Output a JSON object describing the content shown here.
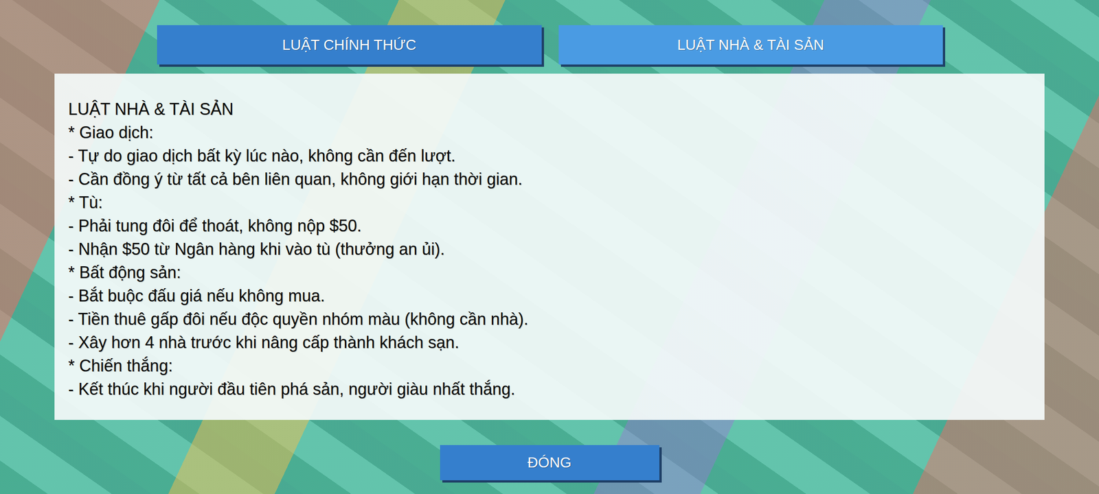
{
  "tabs": [
    {
      "label": "LUẬT CHÍNH THỨC",
      "selected": false
    },
    {
      "label": "LUẬT NHÀ & TÀI SẢN",
      "selected": true
    }
  ],
  "panel": {
    "lines": [
      {
        "kind": "title",
        "text": "LUẬT NHÀ & TÀI SẢN"
      },
      {
        "kind": "section",
        "text": "* Giao dịch:"
      },
      {
        "kind": "item",
        "text": "- Tự do giao dịch bất kỳ lúc nào, không cần đến lượt."
      },
      {
        "kind": "item",
        "text": "- Cần đồng ý từ tất cả bên liên quan, không giới hạn thời gian."
      },
      {
        "kind": "section",
        "text": "* Tù:"
      },
      {
        "kind": "item",
        "text": "- Phải tung đôi để thoát, không nộp $50."
      },
      {
        "kind": "item",
        "text": "- Nhận $50 từ Ngân hàng khi vào tù (thưởng an ủi)."
      },
      {
        "kind": "section",
        "text": "* Bất động sản:"
      },
      {
        "kind": "item",
        "text": "- Bắt buộc đấu giá nếu không mua."
      },
      {
        "kind": "item",
        "text": "- Tiền thuê gấp đôi nếu độc quyền nhóm màu (không cần nhà)."
      },
      {
        "kind": "item",
        "text": "- Xây hơn 4 nhà trước khi nâng cấp thành khách sạn."
      },
      {
        "kind": "section",
        "text": "* Chiến thắng:"
      },
      {
        "kind": "item",
        "text": "- Kết thúc khi người đầu tiên phá sản, người giàu nhất thắng."
      }
    ]
  },
  "buttons": [
    "ĐÓNG"
  ]
}
